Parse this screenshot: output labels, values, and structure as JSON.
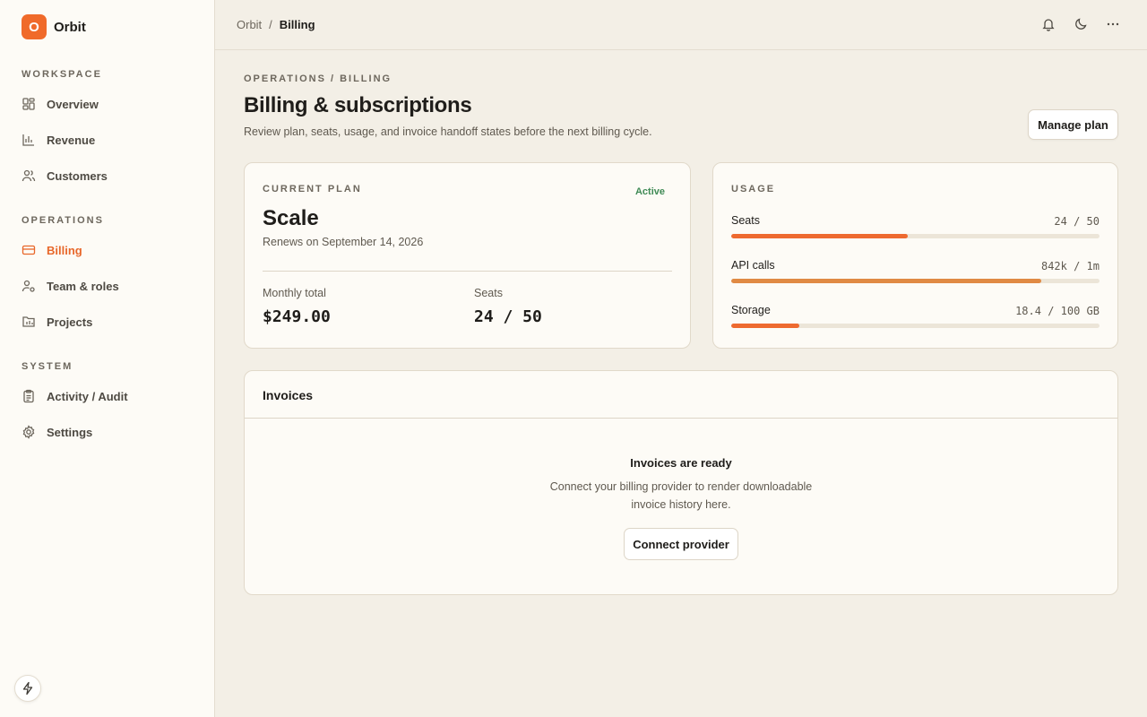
{
  "brand": {
    "logo_letter": "O",
    "name": "Orbit"
  },
  "sidebar": {
    "sections": [
      {
        "heading": "WORKSPACE",
        "items": [
          {
            "label": "Overview",
            "icon": "overview-icon"
          },
          {
            "label": "Revenue",
            "icon": "bar-chart-icon"
          },
          {
            "label": "Customers",
            "icon": "users-icon"
          }
        ]
      },
      {
        "heading": "OPERATIONS",
        "items": [
          {
            "label": "Billing",
            "icon": "credit-card-icon",
            "active": true
          },
          {
            "label": "Team & roles",
            "icon": "user-cog-icon"
          },
          {
            "label": "Projects",
            "icon": "projects-icon"
          }
        ]
      },
      {
        "heading": "SYSTEM",
        "items": [
          {
            "label": "Activity / Audit",
            "icon": "clipboard-icon"
          },
          {
            "label": "Settings",
            "icon": "gear-icon"
          }
        ]
      }
    ]
  },
  "topbar": {
    "breadcrumb": {
      "root": "Orbit",
      "separator": "/",
      "current": "Billing"
    },
    "icons": [
      "bell-icon",
      "moon-icon",
      "more-icon"
    ]
  },
  "page": {
    "eyebrow": "OPERATIONS / BILLING",
    "title": "Billing & subscriptions",
    "description": "Review plan, seats, usage, and invoice handoff states before the next billing cycle.",
    "manage_label": "Manage plan"
  },
  "plan": {
    "heading": "CURRENT PLAN",
    "status": "Active",
    "name": "Scale",
    "renews": "Renews on September 14, 2026",
    "monthly_label": "Monthly total",
    "monthly_value": "$249.00",
    "seats_label": "Seats",
    "seats_value": "24 / 50"
  },
  "usage": {
    "heading": "USAGE",
    "rows": [
      {
        "name": "Seats",
        "amount": "24 / 50",
        "fraction": 0.48,
        "color": "#ee6a30"
      },
      {
        "name": "API calls",
        "amount": "842k / 1m",
        "fraction": 0.842,
        "color": "#e08a44"
      },
      {
        "name": "Storage",
        "amount": "18.4 / 100 GB",
        "fraction": 0.184,
        "color": "#ee6a30"
      }
    ]
  },
  "invoices": {
    "title": "Invoices",
    "empty_title": "Invoices are ready",
    "empty_desc": "Connect your billing provider to render downloadable invoice history here.",
    "connect_label": "Connect provider"
  },
  "colors": {
    "accent": "#f06a2a",
    "active_nav": "#e8672a",
    "status_active": "#3f8a55"
  }
}
